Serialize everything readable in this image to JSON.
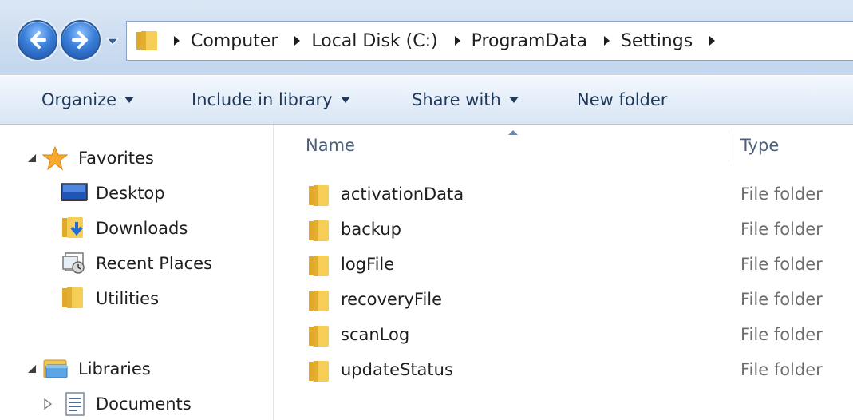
{
  "addressBar": {
    "crumbs": [
      "Computer",
      "Local Disk (C:)",
      "ProgramData",
      "Settings"
    ]
  },
  "commandBar": {
    "organize": "Organize",
    "include": "Include in library",
    "share": "Share with",
    "newFolder": "New folder"
  },
  "navPane": {
    "favorites": {
      "label": "Favorites",
      "items": [
        "Desktop",
        "Downloads",
        "Recent Places",
        "Utilities"
      ]
    },
    "libraries": {
      "label": "Libraries",
      "items": [
        "Documents"
      ]
    }
  },
  "fileList": {
    "columns": {
      "name": "Name",
      "type": "Type"
    },
    "rows": [
      {
        "name": "activationData",
        "type": "File folder"
      },
      {
        "name": "backup",
        "type": "File folder"
      },
      {
        "name": "logFile",
        "type": "File folder"
      },
      {
        "name": "recoveryFile",
        "type": "File folder"
      },
      {
        "name": "scanLog",
        "type": "File folder"
      },
      {
        "name": "updateStatus",
        "type": "File folder"
      }
    ]
  },
  "icons": {
    "back": "back-arrow-icon",
    "forward": "forward-arrow-icon",
    "folder": "folder-icon",
    "favorites": "star-icon",
    "desktop": "desktop-icon",
    "downloads": "downloads-folder-icon",
    "recentPlaces": "recent-places-icon",
    "libraries": "libraries-icon",
    "documents": "document-icon"
  },
  "colors": {
    "chromeBlue": "#cfdff1",
    "commandText": "#1e395b",
    "folderYellow": "#f3c64d",
    "navBlue": "#3a7fd8"
  }
}
